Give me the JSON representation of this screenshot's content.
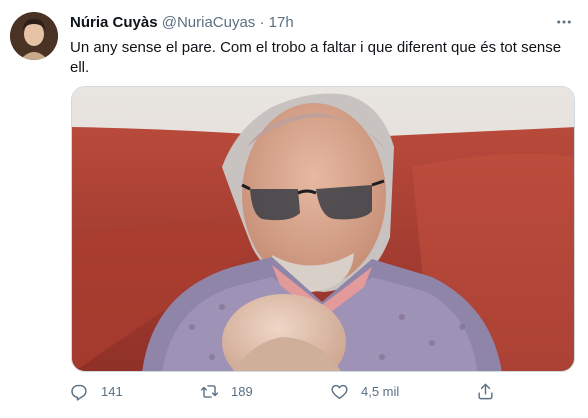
{
  "tweet": {
    "author": {
      "display_name": "Núria Cuyàs",
      "handle": "@NuriaCuyas",
      "avatar_icon": "user-avatar"
    },
    "separator": "·",
    "time": "17h",
    "text": "Un any sense el pare. Com el trobo a faltar i que diferent que és tot sense ell.",
    "media": {
      "type": "photo",
      "icon": "photo-elderly-man-with-baby"
    },
    "actions": {
      "reply": {
        "icon": "reply-icon",
        "count": "141"
      },
      "retweet": {
        "icon": "retweet-icon",
        "count": "189"
      },
      "like": {
        "icon": "heart-icon",
        "count": "4,5 mil"
      },
      "share": {
        "icon": "share-icon"
      }
    },
    "colors": {
      "text_primary": "#0f1419",
      "text_secondary": "#5b7083",
      "border": "#cfd9de"
    }
  }
}
